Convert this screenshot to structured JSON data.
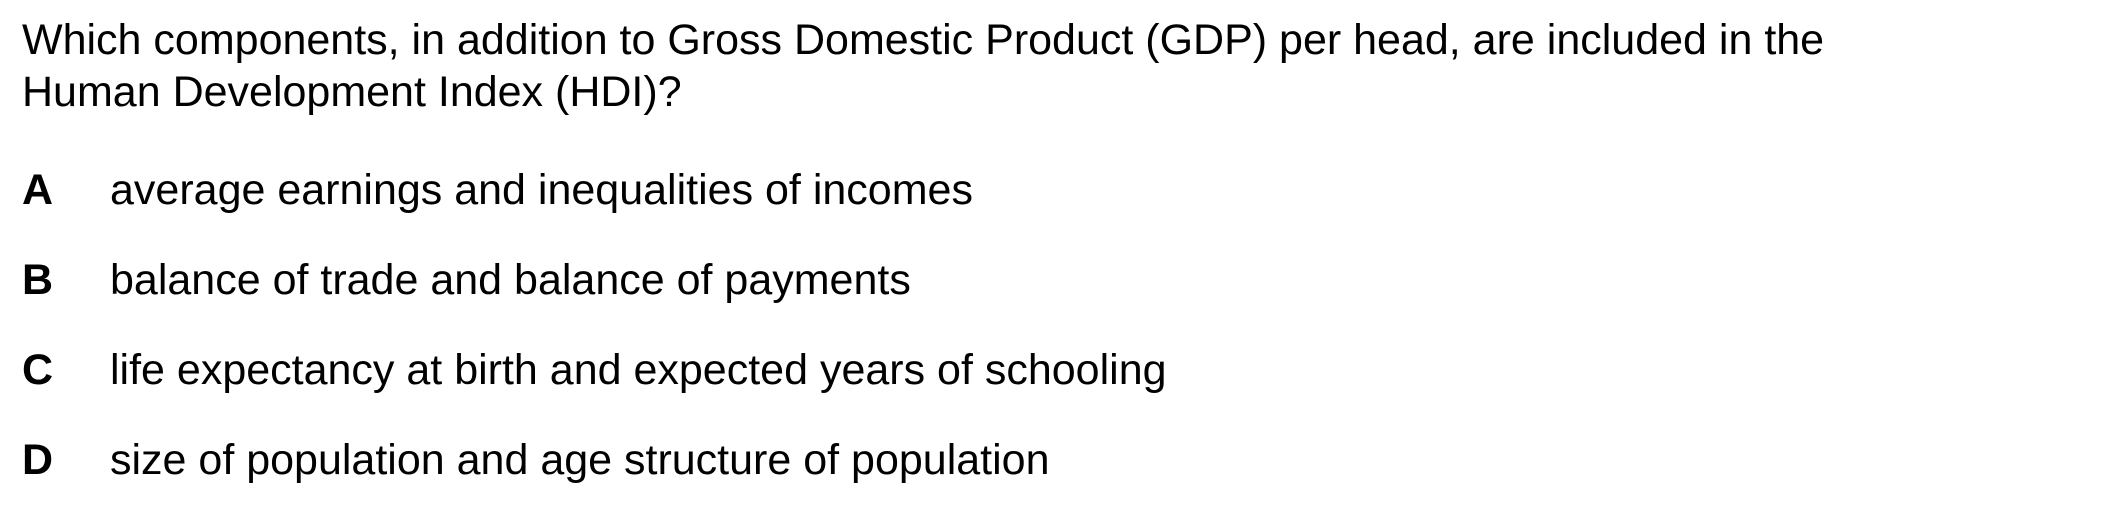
{
  "question": {
    "line1": "Which components, in addition to Gross Domestic Product (GDP) per head, are included in the",
    "line2": "Human Development Index (HDI)?"
  },
  "options": [
    {
      "letter": "A",
      "text": "average earnings and inequalities of incomes"
    },
    {
      "letter": "B",
      "text": "balance of trade and balance of payments"
    },
    {
      "letter": "C",
      "text": "life expectancy at birth and expected years of schooling"
    },
    {
      "letter": "D",
      "text": "size of population and age structure of population"
    }
  ]
}
